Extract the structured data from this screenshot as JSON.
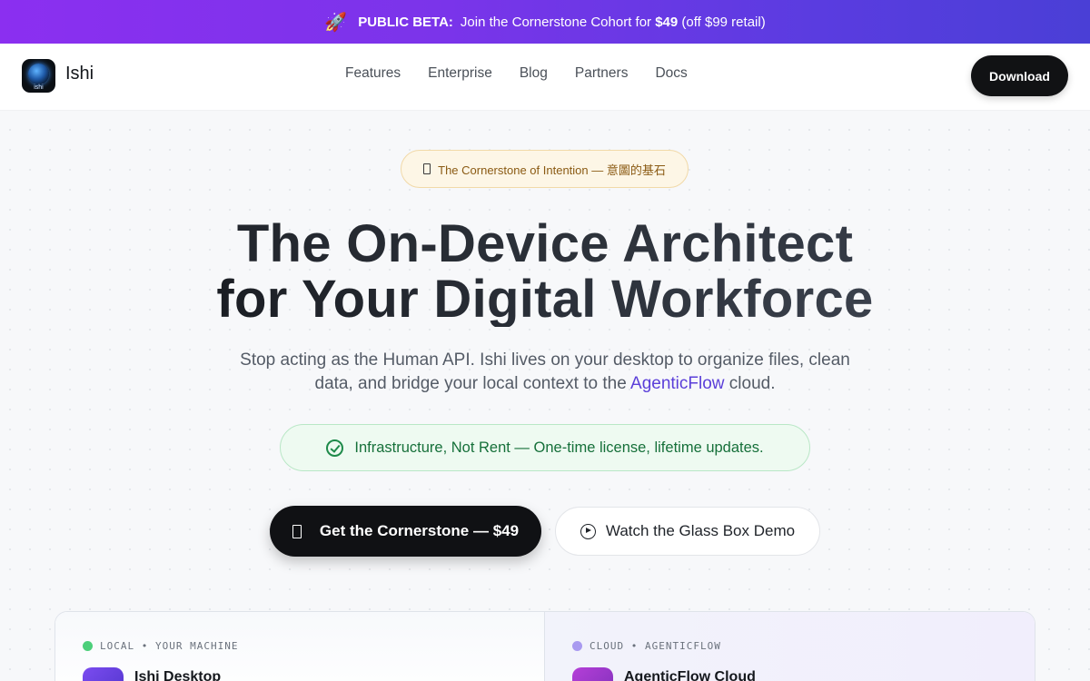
{
  "promo": {
    "icon": "rocket-icon",
    "badge": "PUBLIC BETA:",
    "text": "Join the Cornerstone Cohort for",
    "price": "$49",
    "suffix": "(off $99 retail)"
  },
  "nav": {
    "brand": "Ishi",
    "logo_text": "ishi",
    "links": [
      "Features",
      "Enterprise",
      "Blog",
      "Partners",
      "Docs"
    ],
    "download": "Download"
  },
  "hero": {
    "tag": "The Cornerstone of Intention — 意圖的基石",
    "headline_line1": "The On-Device Architect",
    "headline_line2": "for Your Digital Workforce",
    "sub_line1": "Stop acting as the Human API. Ishi lives on your desktop to organize files, clean",
    "sub_line2_before": "data, and bridge your local context to the",
    "sub_accent": "AgenticFlow",
    "sub_line2_after": "cloud.",
    "promise": "Infrastructure, Not Rent — One-time license, lifetime updates.",
    "cta_primary": "Get the Cornerstone — $49",
    "cta_secondary": "Watch the Glass Box Demo"
  },
  "panel": {
    "left_label": "LOCAL • YOUR MACHINE",
    "left_title": "Ishi Desktop",
    "right_label": "CLOUD • AGENTICFLOW",
    "right_title": "AgenticFlow Cloud"
  },
  "colors": {
    "banner_start": "#8b2ff0",
    "banner_end": "#4a3fd6",
    "accent": "#5b3fd9",
    "success": "#1e8a4a",
    "local_dot": "#4ccf7a",
    "cloud_dot": "#a99af0"
  }
}
